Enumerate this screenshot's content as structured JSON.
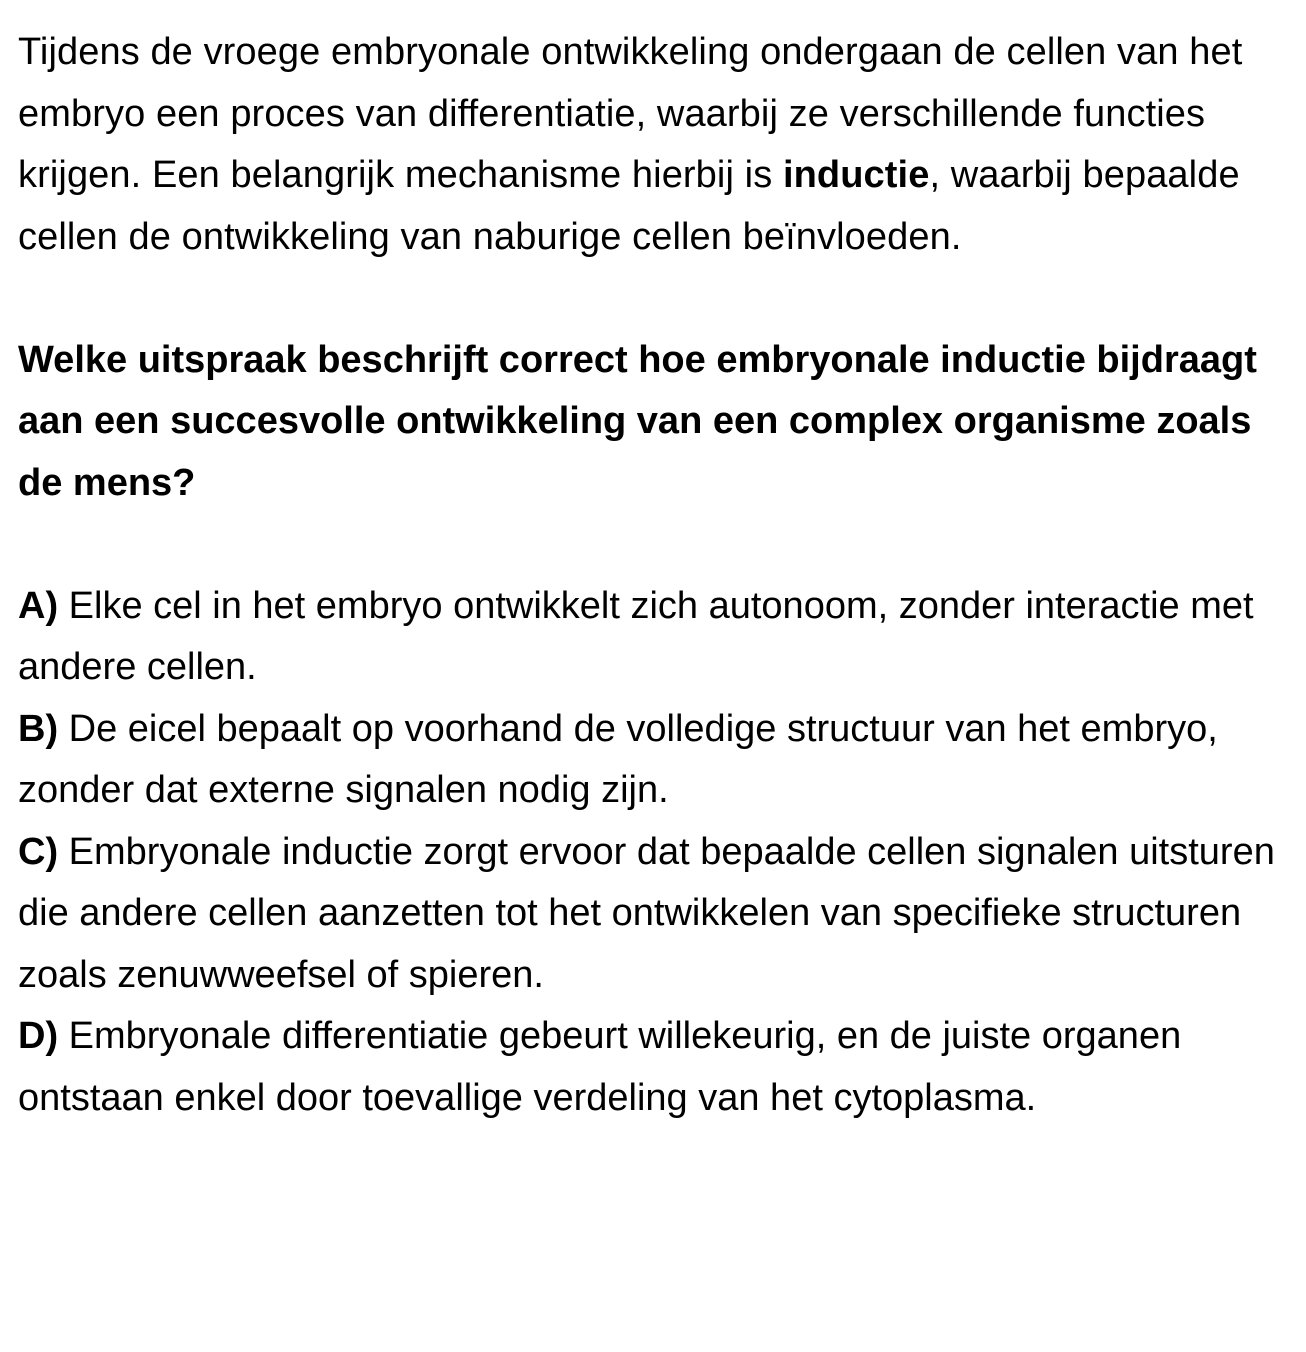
{
  "intro": {
    "before_bold": "Tijdens de vroege embryonale ontwikkeling ondergaan de cellen van het embryo een proces van differentiatie, waarbij ze verschillende functies krijgen. Een belangrijk mechanisme hierbij is ",
    "bold_term": "inductie",
    "after_bold": ", waarbij bepaalde cellen de ontwikkeling van naburige cellen beïnvloeden."
  },
  "question": "Welke uitspraak beschrijft correct hoe embryonale inductie bijdraagt aan een succesvolle ontwikkeling van een complex organisme zoals de mens?",
  "options": [
    {
      "letter": "A)",
      "text": " Elke cel in het embryo ontwikkelt zich autonoom, zonder interactie met andere cellen."
    },
    {
      "letter": "B)",
      "text": " De eicel bepaalt op voorhand de volledige structuur van het embryo, zonder dat externe signalen nodig zijn."
    },
    {
      "letter": "C)",
      "text": " Embryonale inductie zorgt ervoor dat bepaalde cellen signalen uitsturen die andere cellen aanzetten tot het ontwikkelen van specifieke structuren zoals zenuwweefsel of spieren."
    },
    {
      "letter": "D)",
      "text": " Embryonale differentiatie gebeurt willekeurig, en de juiste organen ontstaan enkel door toevallige verdeling van het cytoplasma."
    }
  ]
}
